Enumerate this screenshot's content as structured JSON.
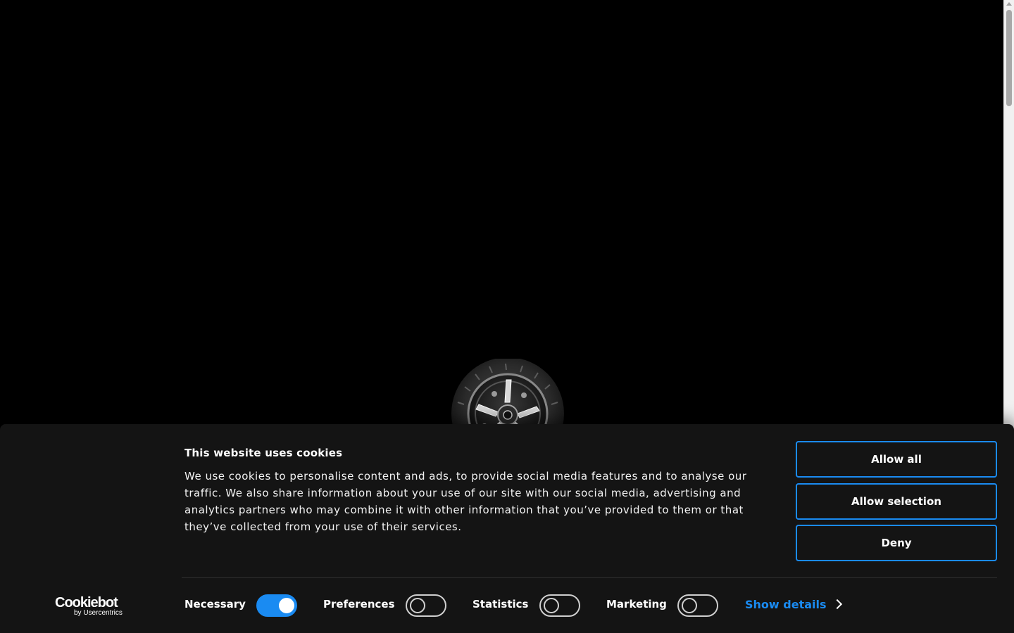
{
  "cookie_banner": {
    "title": "This website uses cookies",
    "description": "We use cookies to personalise content and ads, to provide social media features and to analyse our traffic. We also share information about your use of our site with our social media, advertising and analytics partners who may combine it with other information that you’ve provided to them or that they’ve collected from your use of their services.",
    "buttons": {
      "allow_all": "Allow all",
      "allow_selection": "Allow selection",
      "deny": "Deny"
    },
    "categories": [
      {
        "label": "Necessary",
        "checked": true
      },
      {
        "label": "Preferences",
        "checked": false
      },
      {
        "label": "Statistics",
        "checked": false
      },
      {
        "label": "Marketing",
        "checked": false
      }
    ],
    "show_details": "Show details",
    "logo": {
      "main": "Cookiebot",
      "sub": "by Usercentrics"
    },
    "colors": {
      "accent": "#1a8bf2",
      "background": "#141414"
    }
  },
  "loader": {
    "icon": "wheel-icon"
  }
}
